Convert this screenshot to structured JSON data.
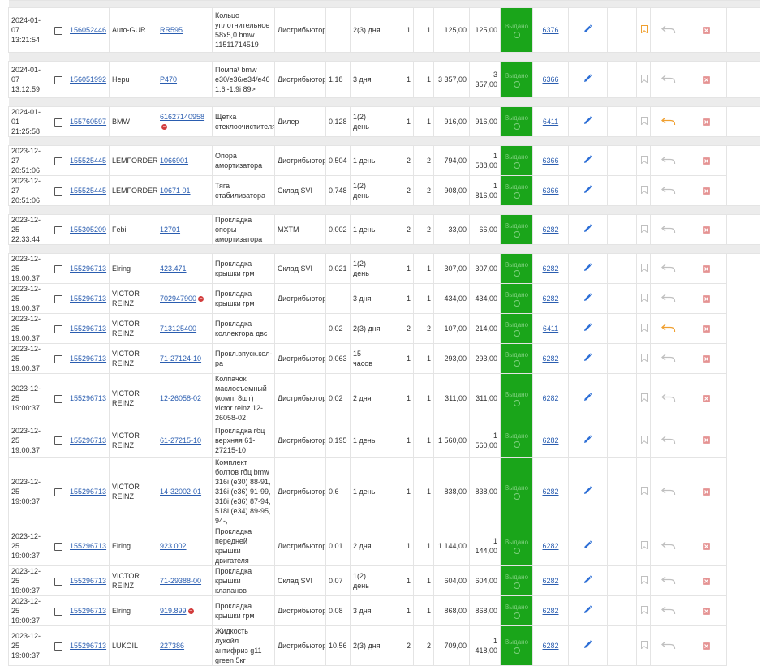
{
  "colors": {
    "status_green": "#1aa51a",
    "link": "#2a5db0",
    "accent_orange": "#f0a030",
    "icon_gray": "#c0c0c0",
    "delete_red": "#e59393"
  },
  "icons": {
    "edit": "pencil-icon",
    "bookmark": "bookmark-icon",
    "return": "return-arrow-icon",
    "delete": "delete-icon"
  },
  "orders": [
    {
      "date": "2024-01-07",
      "time": "13:21:54",
      "order": "156052446",
      "brand": "Auto-GUR",
      "article": "RR595",
      "article_badge": false,
      "desc": "Кольцо уплотнительное 58х5,0 bmw 11511714519",
      "supplier": "Дистрибьютор",
      "weight": "",
      "delivery": "2(3) дня",
      "qty": "1",
      "qty2": "1",
      "price": "125,00",
      "sum": "125,00",
      "status": "Выдано",
      "doc": "6376",
      "bookmark_active": true,
      "return_active": false,
      "gap_before": true
    },
    {
      "date": "2024-01-07",
      "time": "13:12:59",
      "order": "156051992",
      "brand": "Hepu",
      "article": "P470",
      "article_badge": false,
      "desc": "Помпа\\ bmw e30/e36/e34/e46 1.6i-1.9i 89>",
      "supplier": "Дистрибьютор",
      "weight": "1,18",
      "delivery": "3 дня",
      "qty": "1",
      "qty2": "1",
      "price": "3 357,00",
      "sum": "3 357,00",
      "status": "Выдано",
      "doc": "6366",
      "bookmark_active": false,
      "return_active": false,
      "gap_before": true
    },
    {
      "date": "2024-01-01",
      "time": "21:25:58",
      "order": "155760597",
      "brand": "BMW",
      "article": "61627140958",
      "article_badge": true,
      "desc": "Щетка стеклоочистителя",
      "supplier": "Дилер",
      "weight": "0,128",
      "delivery": "1(2) день",
      "qty": "1",
      "qty2": "1",
      "price": "916,00",
      "sum": "916,00",
      "status": "Выдано",
      "doc": "6411",
      "bookmark_active": false,
      "return_active": true,
      "gap_before": true
    },
    {
      "date": "2023-12-27",
      "time": "20:51:06",
      "order": "155525445",
      "brand": "LEMFORDER",
      "article": "1066901",
      "article_badge": false,
      "desc": "Опора амортизатора",
      "supplier": "Дистрибьютор",
      "weight": "0,504",
      "delivery": "1 день",
      "qty": "2",
      "qty2": "2",
      "price": "794,00",
      "sum": "1 588,00",
      "status": "Выдано",
      "doc": "6366",
      "bookmark_active": false,
      "return_active": false,
      "gap_before": true
    },
    {
      "date": "2023-12-27",
      "time": "20:51:06",
      "order": "155525445",
      "brand": "LEMFORDER",
      "article": "10671 01",
      "article_badge": false,
      "desc": "Тяга стабилизатора",
      "supplier": "Склад SVI",
      "weight": "0,748",
      "delivery": "1(2) день",
      "qty": "2",
      "qty2": "2",
      "price": "908,00",
      "sum": "1 816,00",
      "status": "Выдано",
      "doc": "6366",
      "bookmark_active": false,
      "return_active": false,
      "gap_before": false
    },
    {
      "date": "2023-12-25",
      "time": "22:33:44",
      "order": "155305209",
      "brand": "Febi",
      "article": "12701",
      "article_badge": false,
      "desc": "Прокладка опоры амортизатора",
      "supplier": "MXTM",
      "weight": "0,002",
      "delivery": "1 день",
      "qty": "2",
      "qty2": "2",
      "price": "33,00",
      "sum": "66,00",
      "status": "Выдано",
      "doc": "6282",
      "bookmark_active": false,
      "return_active": false,
      "gap_before": true
    },
    {
      "date": "2023-12-25",
      "time": "19:00:37",
      "order": "155296713",
      "brand": "Elring",
      "article": "423.471",
      "article_badge": false,
      "desc": "Прокладка крышки грм",
      "supplier": "Склад SVI",
      "weight": "0,021",
      "delivery": "1(2) день",
      "qty": "1",
      "qty2": "1",
      "price": "307,00",
      "sum": "307,00",
      "status": "Выдано",
      "doc": "6282",
      "bookmark_active": false,
      "return_active": false,
      "gap_before": true
    },
    {
      "date": "2023-12-25",
      "time": "19:00:37",
      "order": "155296713",
      "brand": "VICTOR REINZ",
      "article": "702947900",
      "article_badge": true,
      "desc": "Прокладка крышки грм",
      "supplier": "Дистрибьютор",
      "weight": "",
      "delivery": "3 дня",
      "qty": "1",
      "qty2": "1",
      "price": "434,00",
      "sum": "434,00",
      "status": "Выдано",
      "doc": "6282",
      "bookmark_active": false,
      "return_active": false,
      "gap_before": false
    },
    {
      "date": "2023-12-25",
      "time": "19:00:37",
      "order": "155296713",
      "brand": "VICTOR REINZ",
      "article": "713125400",
      "article_badge": false,
      "desc": "Прокладка коллектора двс",
      "supplier": "",
      "weight": "0,02",
      "delivery": "2(3) дня",
      "qty": "2",
      "qty2": "2",
      "price": "107,00",
      "sum": "214,00",
      "status": "Выдано",
      "doc": "6411",
      "bookmark_active": false,
      "return_active": true,
      "gap_before": false
    },
    {
      "date": "2023-12-25",
      "time": "19:00:37",
      "order": "155296713",
      "brand": "VICTOR REINZ",
      "article": "71-27124-10",
      "article_badge": false,
      "desc": "Прокл.впуск.кол-ра",
      "supplier": "Дистрибьютор",
      "weight": "0,063",
      "delivery": "15 часов",
      "qty": "1",
      "qty2": "1",
      "price": "293,00",
      "sum": "293,00",
      "status": "Выдано",
      "doc": "6282",
      "bookmark_active": false,
      "return_active": false,
      "gap_before": false
    },
    {
      "date": "2023-12-25",
      "time": "19:00:37",
      "order": "155296713",
      "brand": "VICTOR REINZ",
      "article": "12-26058-02",
      "article_badge": false,
      "desc": "Колпачок маслосъемный (комп. 8шт) victor reinz 12-26058-02",
      "supplier": "Дистрибьютор",
      "weight": "0,02",
      "delivery": "2 дня",
      "qty": "1",
      "qty2": "1",
      "price": "311,00",
      "sum": "311,00",
      "status": "Выдано",
      "doc": "6282",
      "bookmark_active": false,
      "return_active": false,
      "gap_before": false
    },
    {
      "date": "2023-12-25",
      "time": "19:00:37",
      "order": "155296713",
      "brand": "VICTOR REINZ",
      "article": "61-27215-10",
      "article_badge": false,
      "desc": "Прокладка гбц верхняя 61-27215-10",
      "supplier": "Дистрибьютор",
      "weight": "0,195",
      "delivery": "1 день",
      "qty": "1",
      "qty2": "1",
      "price": "1 560,00",
      "sum": "1 560,00",
      "status": "Выдано",
      "doc": "6282",
      "bookmark_active": false,
      "return_active": false,
      "gap_before": false
    },
    {
      "date": "2023-12-25",
      "time": "19:00:37",
      "order": "155296713",
      "brand": "VICTOR REINZ",
      "article": "14-32002-01",
      "article_badge": false,
      "desc": "Комплект болтов гбц bmw 316i (e30) 88-91, 316i (e36) 91-99, 318i (e36) 87-94, 518i (e34) 89-95, 94-,",
      "supplier": "Дистрибьютор",
      "weight": "0,6",
      "delivery": "1 день",
      "qty": "1",
      "qty2": "1",
      "price": "838,00",
      "sum": "838,00",
      "status": "Выдано",
      "doc": "6282",
      "bookmark_active": false,
      "return_active": false,
      "gap_before": false
    },
    {
      "date": "2023-12-25",
      "time": "19:00:37",
      "order": "155296713",
      "brand": "Elring",
      "article": "923.002",
      "article_badge": false,
      "desc": "Прокладка передней крышки двигателя",
      "supplier": "Дистрибьютор",
      "weight": "0,01",
      "delivery": "2 дня",
      "qty": "1",
      "qty2": "1",
      "price": "1 144,00",
      "sum": "1 144,00",
      "status": "Выдано",
      "doc": "6282",
      "bookmark_active": false,
      "return_active": false,
      "gap_before": false
    },
    {
      "date": "2023-12-25",
      "time": "19:00:37",
      "order": "155296713",
      "brand": "VICTOR REINZ",
      "article": "71-29388-00",
      "article_badge": false,
      "desc": "Прокладка крышки клапанов",
      "supplier": "Склад SVI",
      "weight": "0,07",
      "delivery": "1(2) день",
      "qty": "1",
      "qty2": "1",
      "price": "604,00",
      "sum": "604,00",
      "status": "Выдано",
      "doc": "6282",
      "bookmark_active": false,
      "return_active": false,
      "gap_before": false
    },
    {
      "date": "2023-12-25",
      "time": "19:00:37",
      "order": "155296713",
      "brand": "Elring",
      "article": "919.899",
      "article_badge": true,
      "desc": "Прокладка крышки грм",
      "supplier": "Дистрибьютор",
      "weight": "0,08",
      "delivery": "3 дня",
      "qty": "1",
      "qty2": "1",
      "price": "868,00",
      "sum": "868,00",
      "status": "Выдано",
      "doc": "6282",
      "bookmark_active": false,
      "return_active": false,
      "gap_before": false
    },
    {
      "date": "2023-12-25",
      "time": "19:00:37",
      "order": "155296713",
      "brand": "LUKOIL",
      "article": "227386",
      "article_badge": false,
      "desc": "Жидкость лукойл антифриз g11 green 5кг",
      "supplier": "Дистрибьютор",
      "weight": "10,56",
      "delivery": "2(3) дня",
      "qty": "2",
      "qty2": "2",
      "price": "709,00",
      "sum": "1 418,00",
      "status": "Выдано",
      "doc": "6282",
      "bookmark_active": false,
      "return_active": false,
      "gap_before": false
    }
  ]
}
